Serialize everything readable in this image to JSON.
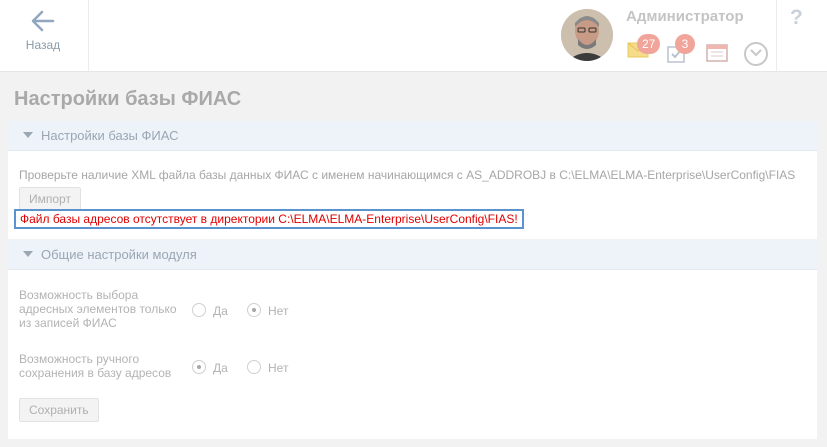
{
  "header": {
    "back_label": "Назад",
    "user_name": "Администратор",
    "mail_count": "27",
    "tasks_count": "3",
    "help_label": "?"
  },
  "page": {
    "title": "Настройки базы ФИАС"
  },
  "fias_section": {
    "title": "Настройки базы ФИАС",
    "description": "Проверьте наличие XML файла базы данных ФИАС с именем начинающимся с AS_ADDROBJ в C:\\ELMA\\ELMA-Enterprise\\UserConfig\\FIAS",
    "import_label": "Импорт",
    "error_message": "Файл базы адресов отсутствует в директории C:\\ELMA\\ELMA-Enterprise\\UserConfig\\FIAS!"
  },
  "module_section": {
    "title": "Общие настройки модуля",
    "option_fias_only": {
      "label": "Возможность выбора адресных элементов только из записей ФИАС",
      "yes_label": "Да",
      "no_label": "Нет",
      "selected": "Нет"
    },
    "option_manual_save": {
      "label": "Возможность ручного сохранения в базу адресов",
      "yes_label": "Да",
      "no_label": "Нет",
      "selected": "Да"
    },
    "save_label": "Сохранить"
  },
  "colors": {
    "error": "#e00000",
    "section_header_bg": "#eef3f9",
    "highlight_border": "#5b93cf",
    "badge": "#f0a49a"
  }
}
